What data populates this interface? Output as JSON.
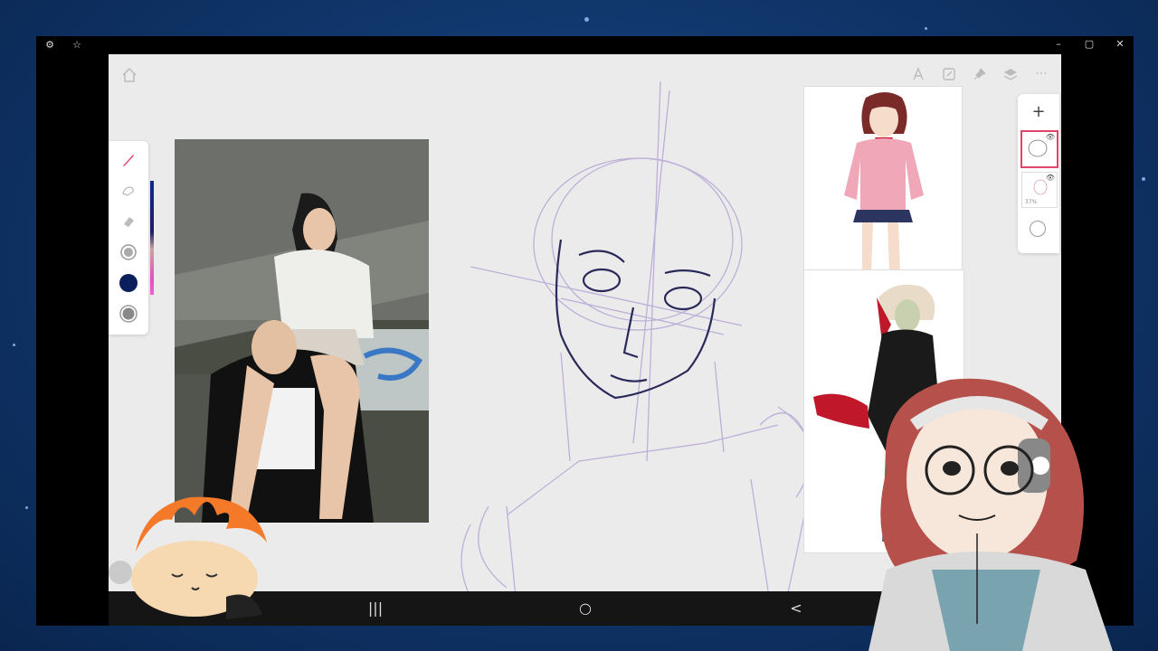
{
  "window": {
    "settings_icon": "⚙",
    "star_icon": "☆",
    "minimize": "–",
    "maximize": "▢",
    "close": "✕"
  },
  "toolbar": {
    "icons": [
      "home-icon",
      "ruler-icon",
      "edit-icon",
      "pin-icon",
      "layers-icon",
      "more-icon"
    ],
    "more_label": "···"
  },
  "palette": {
    "tools": [
      "brush-icon",
      "smudge-icon",
      "eraser-icon",
      "brush-size",
      "color-swatch",
      "opacity-swatch"
    ],
    "active_color": "#0b1f5c",
    "accent": "#e0446a"
  },
  "layers": {
    "add_label": "+",
    "opacity_label": "37%",
    "eye_icon": "👁"
  },
  "navbar": {
    "recents_label": "|||",
    "home_label": "○",
    "back_label": "<"
  }
}
